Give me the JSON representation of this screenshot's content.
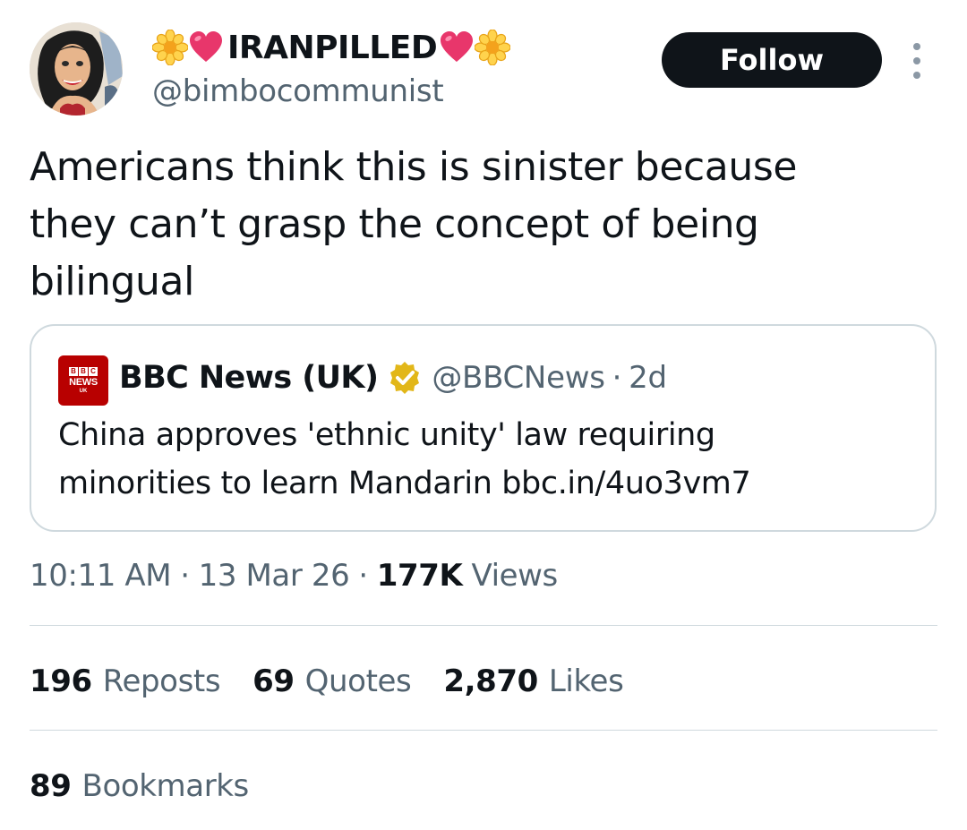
{
  "author": {
    "display_name": "IRANPILLED",
    "handle": "@bimbocommunist",
    "name_emojis": [
      "flower-emoji",
      "heart-emoji",
      "heart-emoji",
      "flower-emoji"
    ]
  },
  "follow_button": {
    "label": "Follow"
  },
  "tweet": {
    "text_lines": [
      "Americans think this is sinister because",
      "they can’t grasp the concept of being",
      "bilingual"
    ]
  },
  "quoted_tweet": {
    "logo_text": {
      "blocks": [
        "B",
        "B",
        "C"
      ],
      "line1": "NEWS",
      "line2": "UK"
    },
    "display_name": "BBC News (UK)",
    "verified_icon": "gold-verified-badge-icon",
    "handle": "@BBCNews",
    "separator": "·",
    "time": "2d",
    "text_lines": [
      "China approves 'ethnic unity' law requiring",
      "minorities to learn Mandarin bbc.in/4uo3vm7"
    ]
  },
  "meta": {
    "time": "10:11 AM",
    "separator": "·",
    "date": "13 Mar 26",
    "views_count": "177K",
    "views_label": "Views"
  },
  "stats": {
    "reposts": {
      "count": "196",
      "label": "Reposts"
    },
    "quotes": {
      "count": "69",
      "label": "Quotes"
    },
    "likes": {
      "count": "2,870",
      "label": "Likes"
    },
    "bookmarks": {
      "count": "89",
      "label": "Bookmarks"
    }
  },
  "colors": {
    "text_primary": "#0f1419",
    "text_secondary": "#536471",
    "border": "#cfd9de",
    "follow_bg": "#0f1419",
    "bbc_red": "#b80000",
    "verified_gold": "#e2b719"
  }
}
